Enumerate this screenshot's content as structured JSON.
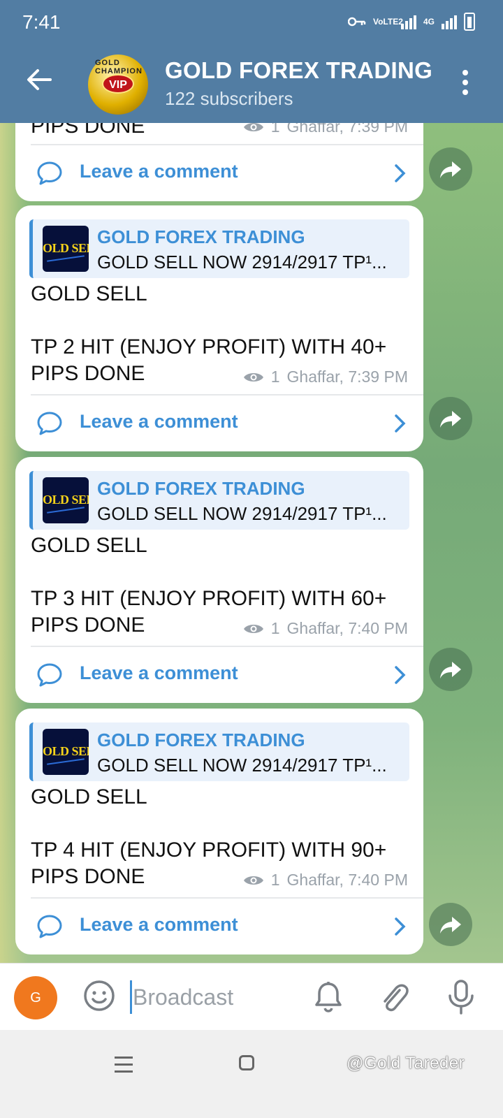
{
  "status_bar": {
    "time": "7:41",
    "net_label": "VoLTE2",
    "net_type": "4G"
  },
  "header": {
    "title": "GOLD FOREX TRADING",
    "subscribers": "122 subscribers",
    "avatar_ring_text": "GOLD CHAMPION",
    "avatar_badge": "VIP"
  },
  "messages": [
    {
      "text": "PIPS DONE",
      "views": "1",
      "author_time": "Ghaffar, 7:39 PM",
      "comment_label": "Leave a comment"
    },
    {
      "quote_name": "GOLD FOREX TRADING",
      "quote_text": "GOLD SELL NOW 2914/2917  TP¹...",
      "thumb_text": "OLD SEL",
      "text": "GOLD SELL\n\nTP 2 HIT (ENJOY PROFIT)  WITH 40+\nPIPS DONE",
      "views": "1",
      "author_time": "Ghaffar, 7:39 PM",
      "comment_label": "Leave a comment"
    },
    {
      "quote_name": "GOLD FOREX TRADING",
      "quote_text": "GOLD SELL NOW 2914/2917  TP¹...",
      "thumb_text": "OLD SEL",
      "text": "GOLD SELL\n\nTP 3 HIT (ENJOY PROFIT)  WITH 60+\nPIPS DONE",
      "views": "1",
      "author_time": "Ghaffar, 7:40 PM",
      "comment_label": "Leave a comment"
    },
    {
      "quote_name": "GOLD FOREX TRADING",
      "quote_text": "GOLD SELL NOW 2914/2917  TP¹...",
      "thumb_text": "OLD SEL",
      "text": "GOLD SELL\n\nTP 4 HIT (ENJOY PROFIT)  WITH 90+\nPIPS DONE",
      "views": "1",
      "author_time": "Ghaffar, 7:40 PM",
      "comment_label": "Leave a comment"
    }
  ],
  "composer": {
    "avatar_initial": "G",
    "placeholder": "Broadcast"
  },
  "watermark": "@Gold Tareder",
  "colors": {
    "header": "#527da3",
    "accent": "#3d8fd6",
    "user_avatar": "#f0781e"
  }
}
